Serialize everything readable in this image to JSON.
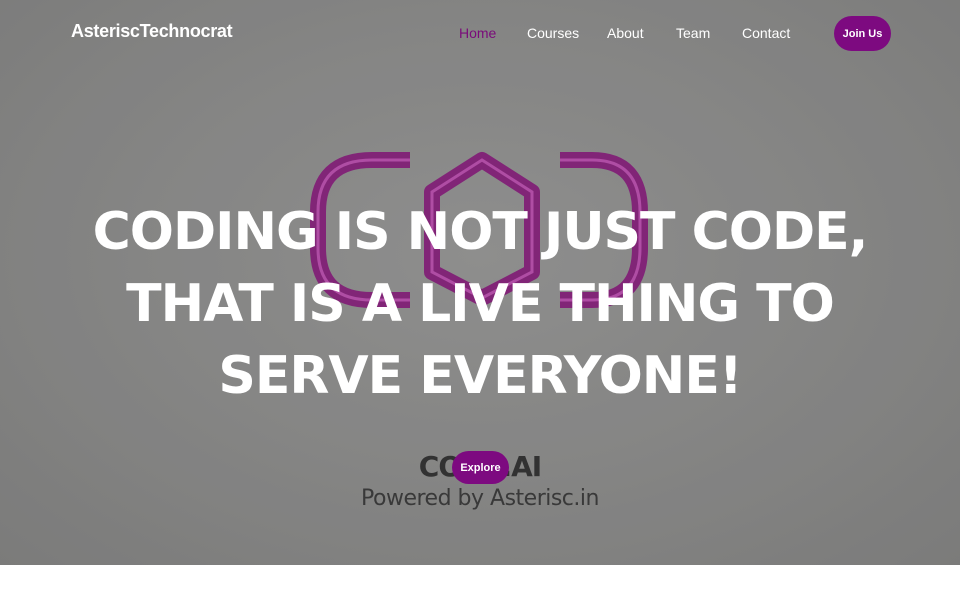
{
  "brand": {
    "name": "AsteriscTechnocrat"
  },
  "nav": {
    "items": [
      {
        "label": "Home",
        "active": true
      },
      {
        "label": "Courses",
        "active": false
      },
      {
        "label": "About",
        "active": false
      },
      {
        "label": "Team",
        "active": false
      },
      {
        "label": "Contact",
        "active": false
      }
    ],
    "cta_label": "Join Us"
  },
  "hero": {
    "headline_lines": [
      "CODING IS NOT JUST CODE,",
      "THAT IS A LIVE THING TO",
      "SERVE EVERYONE!"
    ],
    "explore_label": "Explore",
    "background_brand": "CODE.AI",
    "background_tagline": "Powered by Asterisc.in"
  },
  "colors": {
    "accent": "#7d0a80",
    "active_link": "#7a0b7a",
    "hero_background": "#8e8e8d",
    "logo_stroke": "#8a1a7e",
    "text_light": "#ffffff"
  }
}
